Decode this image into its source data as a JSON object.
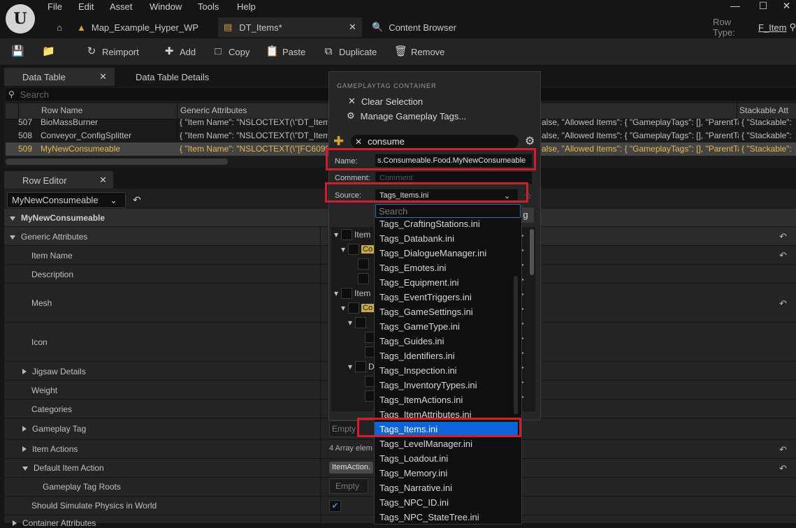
{
  "menu": [
    "File",
    "Edit",
    "Asset",
    "Window",
    "Tools",
    "Help"
  ],
  "doc_tabs": [
    {
      "label": "Map_Example_Hyper_WP"
    },
    {
      "label": "DT_Items*"
    },
    {
      "label": "Content Browser"
    }
  ],
  "row_type": {
    "label": "Row Type:",
    "value": "F_Item"
  },
  "toolbar": {
    "reimport": "Reimport",
    "add": "Add",
    "copy": "Copy",
    "paste": "Paste",
    "duplicate": "Duplicate",
    "remove": "Remove"
  },
  "panels": {
    "data_table": "Data Table",
    "data_table_details": "Data Table Details",
    "row_editor": "Row Editor"
  },
  "data_table": {
    "search_placeholder": "Search",
    "columns": {
      "row_name": "Row Name",
      "generic": "Generic Attributes",
      "stackable": "Stackable Att"
    },
    "rows": [
      {
        "num": "507",
        "name": "BioMassBurner",
        "generic": "{ \"Item Name\": \"NSLOCTEXT(\\\"DT_Items",
        "allowed": "alse, \"Allowed Items\": { \"GameplayTags\": [], \"ParentTa",
        "stackable": "{ \"Stackable\":"
      },
      {
        "num": "508",
        "name": "Conveyor_ConfigSplitter",
        "generic": "{ \"Item Name\": \"NSLOCTEXT(\\\"DT_Items",
        "allowed": "alse, \"Allowed Items\": { \"GameplayTags\": [], \"ParentTa",
        "stackable": "{ \"Stackable\":"
      },
      {
        "num": "509",
        "name": "MyNewConsumeable",
        "generic": "{ \"Item Name\": \"NSLOCTEXT(\\\"[FC6099",
        "allowed": "alse, \"Allowed Items\": { \"GameplayTags\": [], \"ParentTa",
        "stackable": "{ \"Stackable\":"
      }
    ]
  },
  "row_editor": {
    "selected_row": "MyNewConsumeable",
    "header": "MyNewConsumeable",
    "props": {
      "generic": "Generic Attributes",
      "item_name": "Item Name",
      "description": "Description",
      "mesh": "Mesh",
      "icon": "Icon",
      "jigsaw": "Jigsaw Details",
      "weight": "Weight",
      "categories": "Categories",
      "gameplay_tag": "Gameplay Tag",
      "item_actions": "Item Actions",
      "default_item_action": "Default Item Action",
      "gameplay_tag_roots": "Gameplay Tag Roots",
      "simulate_physics": "Should Simulate Physics in World",
      "container": "Container Attributes"
    },
    "values": {
      "gameplay_tag": "Empty",
      "item_actions": "4 Array elem",
      "default_item_action": "ItemAction.",
      "gameplay_tag_roots": "Empty"
    }
  },
  "popup": {
    "section": "GAMEPLAYTAG CONTAINER",
    "clear_selection": "Clear Selection",
    "manage": "Manage Gameplay Tags...",
    "filter_value": "consume",
    "name_label": "Name:",
    "name_value": "s.Consumeable.Food.MyNewConsumeable",
    "comment_label": "Comment:",
    "comment_placeholder": "Comment",
    "source_label": "Source:",
    "source_value": "Tags_Items.ini",
    "tree": [
      "Item",
      "Co",
      "Item",
      "Co",
      "D"
    ],
    "hidden_btn": "g"
  },
  "source_dropdown": {
    "search_placeholder": "Search",
    "selected": "Tags_Items.ini",
    "options": [
      "Tags_CraftingStations.ini",
      "Tags_Databank.ini",
      "Tags_DialogueManager.ini",
      "Tags_Emotes.ini",
      "Tags_Equipment.ini",
      "Tags_EventTriggers.ini",
      "Tags_GameSettings.ini",
      "Tags_GameType.ini",
      "Tags_Guides.ini",
      "Tags_Identifiers.ini",
      "Tags_Inspection.ini",
      "Tags_InventoryTypes.ini",
      "Tags_ItemActions.ini",
      "Tags_ItemAttributes.ini",
      "Tags_Items.ini",
      "Tags_LevelManager.ini",
      "Tags_Loadout.ini",
      "Tags_Memory.ini",
      "Tags_Narrative.ini",
      "Tags_NPC_ID.ini",
      "Tags_NPC_StateTree.ini"
    ]
  },
  "colors": {
    "accent_blue": "#0c64d8",
    "highlight_red": "#d11d2c",
    "selected_row_text": "#e6b94a",
    "tag_chip": "#c8a84b"
  }
}
